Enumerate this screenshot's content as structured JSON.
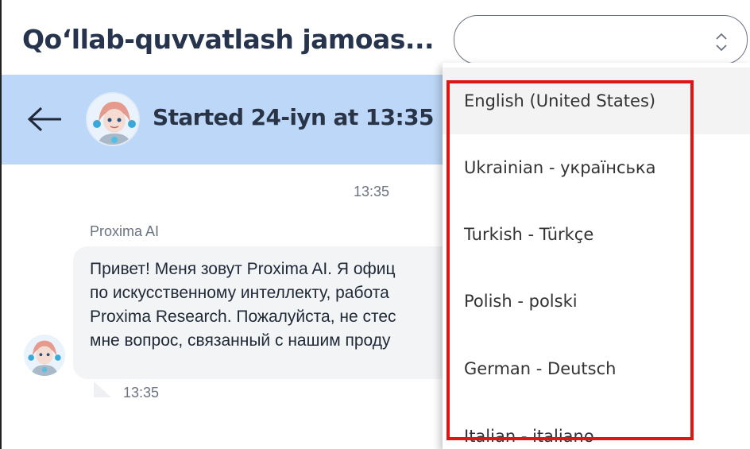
{
  "page": {
    "title": "Qo‘llab-quvvatlash jamoas..."
  },
  "language_select": {
    "selected_value": "",
    "options": [
      "English (United States)",
      "Ukrainian - українська",
      "Turkish - Türkçe",
      "Polish - polski",
      "German - Deutsch",
      "Italian - italiano"
    ],
    "highlighted_index": 0
  },
  "chat_header": {
    "title": "Started 24-iyn at 13:35",
    "back_icon": "arrow-left-icon",
    "avatar_icon": "bot-avatar-icon"
  },
  "conversation": {
    "day_timestamp": "13:35",
    "messages": [
      {
        "sender": "Proxima AI",
        "lines": [
          "Привет! Меня зовут Proxima AI. Я офиц",
          "по искусственному интеллекту, работа",
          "Proxima Research. Пожалуйста, не стес",
          "мне вопрос, связанный с нашим проду"
        ],
        "time": "13:35"
      }
    ]
  },
  "colors": {
    "header_bg": "#bcd7f7",
    "bubble_bg": "#f3f4f6",
    "title_text": "#26354d",
    "annotation_box": "#e01414"
  }
}
